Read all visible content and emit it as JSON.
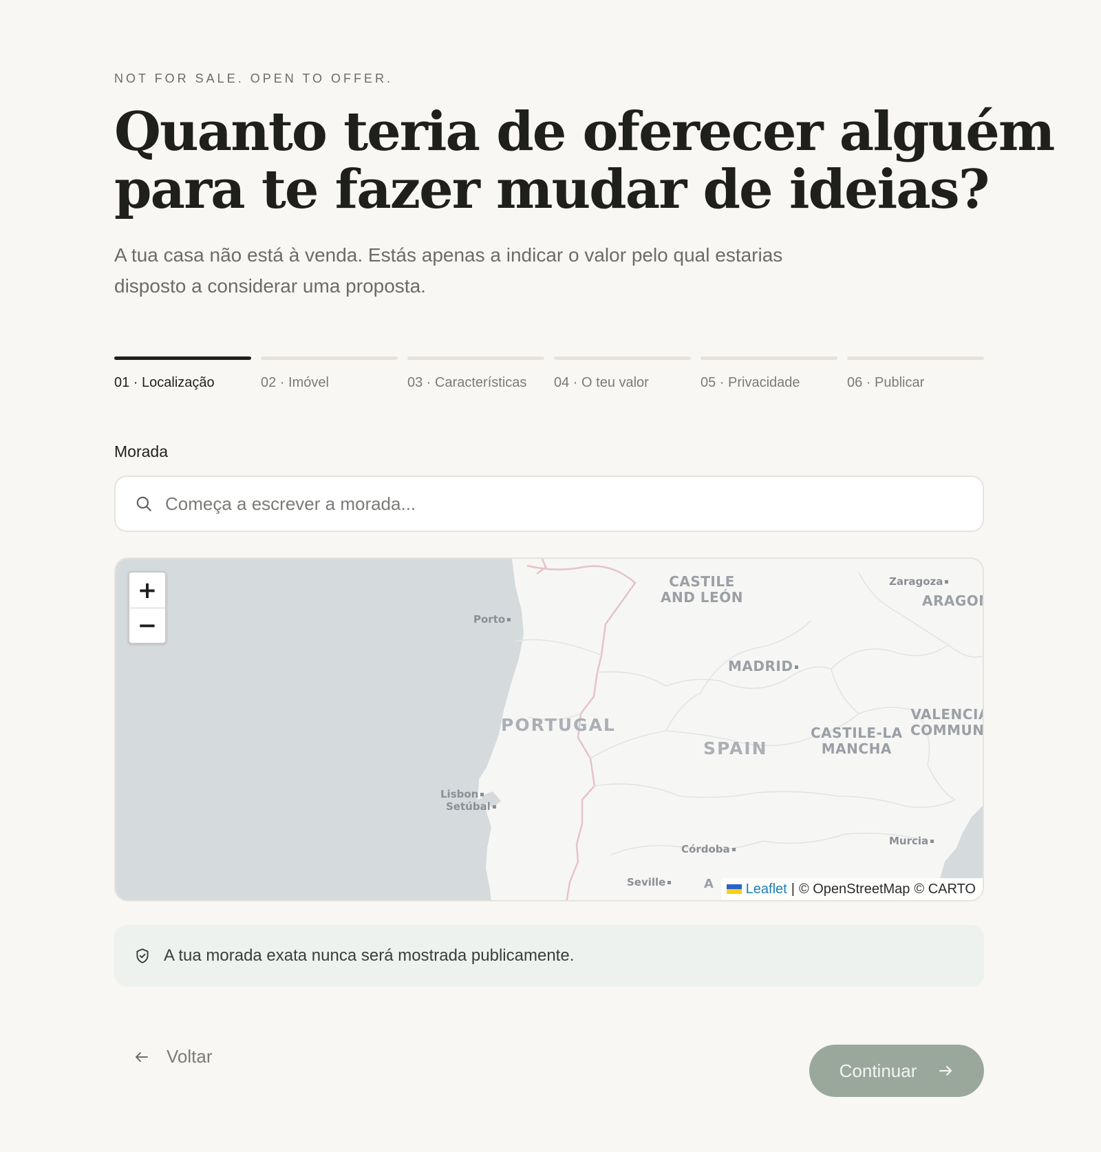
{
  "header": {
    "eyebrow": "NOT FOR SALE. OPEN TO OFFER.",
    "title_line1": "Quanto teria de oferecer alguém",
    "title_line2": "para te fazer mudar de ideias?",
    "subtitle_line1": "A tua casa não está à venda. Estás apenas a indicar o valor pelo qual estarias",
    "subtitle_line2": "disposto a considerar uma proposta."
  },
  "steps": [
    {
      "label": "01 · Localização",
      "active": true
    },
    {
      "label": "02 · Imóvel",
      "active": false
    },
    {
      "label": "03 · Características",
      "active": false
    },
    {
      "label": "04 · O teu valor",
      "active": false
    },
    {
      "label": "05 · Privacidade",
      "active": false
    },
    {
      "label": "06 · Publicar",
      "active": false
    }
  ],
  "address": {
    "label": "Morada",
    "value": "",
    "placeholder": "Começa a escrever a morada..."
  },
  "map": {
    "zoom_in": "+",
    "zoom_out": "−",
    "labels": {
      "porto": "Porto",
      "castile_leon_1": "CASTILE",
      "castile_leon_2": "AND LEÓN",
      "zaragoza": "Zaragoza",
      "aragon": "ARAGON",
      "madrid": "MADRID",
      "portugal": "PORTUGAL",
      "spain": "SPAIN",
      "valencia_1": "VALENCIA",
      "valencia_2": "COMMUNI",
      "castile_mancha_1": "CASTILE-LA",
      "castile_mancha_2": "MANCHA",
      "lisbon": "Lisbon",
      "setubal": "Setúbal",
      "cordoba": "Córdoba",
      "murcia": "Murcia",
      "seville": "Seville",
      "andalusia_partial": "A"
    },
    "attribution": {
      "leaflet": "Leaflet",
      "separator": "|",
      "osm": "© OpenStreetMap",
      "carto": "© CARTO"
    },
    "colors": {
      "sea": "#d5dadd",
      "land": "#f6f6f5",
      "border": "#e6c3c8",
      "region_line": "#e2e2e2"
    }
  },
  "notice": {
    "text": "A tua morada exata nunca será mostrada publicamente.",
    "icon": "shield-check-icon"
  },
  "footer": {
    "back_label": "Voltar",
    "continue_label": "Continuar",
    "continue_color": "#9aa89b"
  }
}
